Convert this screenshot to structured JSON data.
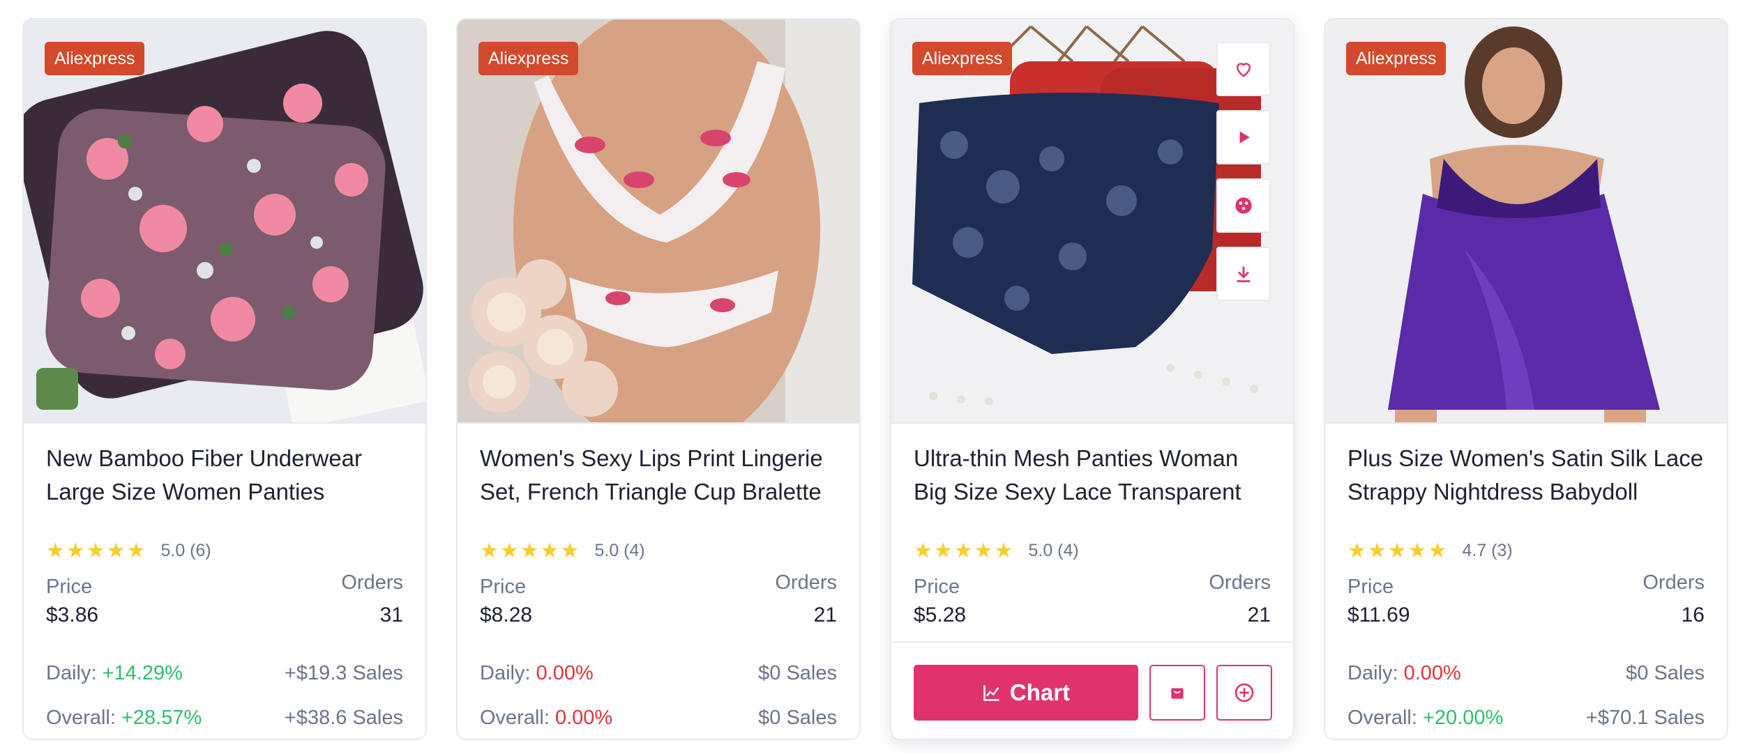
{
  "products": [
    {
      "source": "Aliexpress",
      "title": "New Bamboo Fiber Underwear Large Size Women Panties",
      "stars": "★★★★★",
      "rating": "5.0 (6)",
      "price_label": "Price",
      "price": "$3.86",
      "orders_label": "Orders",
      "orders": "31",
      "daily_label": "Daily:",
      "daily_pct": "+14.29%",
      "daily_sales": "+$19.3 Sales",
      "overall_label": "Overall:",
      "overall_pct": "+28.57%",
      "overall_sales": "+$38.6 Sales"
    },
    {
      "source": "Aliexpress",
      "title": "Women's Sexy Lips Print Lingerie Set, French Triangle Cup Bralette",
      "stars": "★★★★★",
      "rating": "5.0 (4)",
      "price_label": "Price",
      "price": "$8.28",
      "orders_label": "Orders",
      "orders": "21",
      "daily_label": "Daily:",
      "daily_pct": "0.00%",
      "daily_sales": "$0 Sales",
      "overall_label": "Overall:",
      "overall_pct": "0.00%",
      "overall_sales": "$0 Sales"
    },
    {
      "source": "Aliexpress",
      "title": "Ultra-thin Mesh Panties Woman Big Size Sexy Lace Transparent",
      "stars": "★★★★★",
      "rating": "5.0 (4)",
      "price_label": "Price",
      "price": "$5.28",
      "orders_label": "Orders",
      "orders": "21",
      "chart_button": "Chart"
    },
    {
      "source": "Aliexpress",
      "title": "Plus Size Women's Satin Silk Lace Strappy Nightdress Babydoll",
      "stars": "★★★★★",
      "rating": "4.7 (3)",
      "price_label": "Price",
      "price": "$11.69",
      "orders_label": "Orders",
      "orders": "16",
      "daily_label": "Daily:",
      "daily_pct": "0.00%",
      "daily_sales": "$0 Sales",
      "overall_label": "Overall:",
      "overall_pct": "+20.00%",
      "overall_sales": "+$70.1 Sales"
    }
  ],
  "icons": {
    "hover_actions": [
      "heart-icon",
      "play-icon",
      "compare-icon",
      "download-icon"
    ],
    "chart": "line-chart-icon",
    "store": "shopping-bag-icon",
    "add": "plus-circle-icon"
  },
  "colors": {
    "badge": "#d24a2b",
    "accent": "#e0336d",
    "positive": "#2fbd6a",
    "negative": "#e0333a",
    "star": "#f4cf2d"
  }
}
